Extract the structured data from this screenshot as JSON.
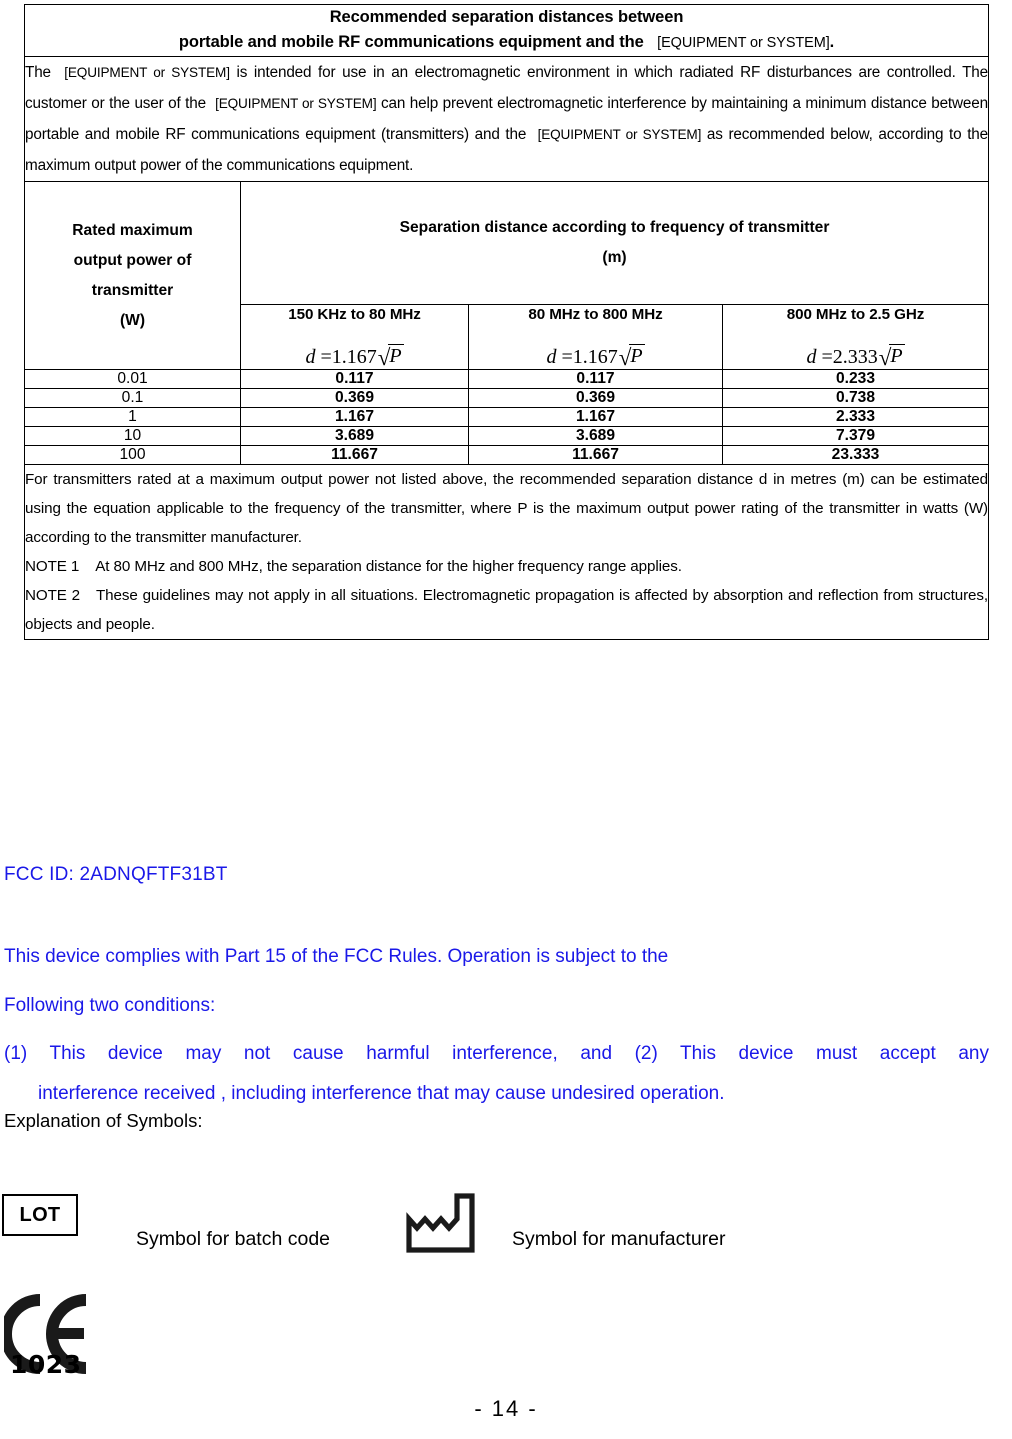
{
  "table": {
    "title_line1": "Recommended separation distances between",
    "title_line2_bold": "portable and mobile RF communications equipment and the",
    "title_line2_bracket": "[EQUIPMENT or SYSTEM]",
    "title_line2_period": ".",
    "intro": {
      "part1": "The",
      "bracket1": "[EQUIPMENT or SYSTEM]",
      "part2": "is intended for use in an electromagnetic environment in which radiated RF disturbances are controlled. The customer or the user of the",
      "bracket2": "[EQUIPMENT or SYSTEM]",
      "part3": "can help prevent electromagnetic interference by maintaining a minimum distance between portable and mobile RF communications equipment (transmitters) and the",
      "bracket3": "[EQUIPMENT or SYSTEM]",
      "part4": "as recommended below, according to the maximum output power of the communications equipment."
    },
    "col_head_left": {
      "l1": "Rated maximum",
      "l2": "output power of",
      "l3": "transmitter",
      "l4": "(W)"
    },
    "col_head_right": {
      "l1": "Separation distance according to frequency of transmitter",
      "l2": "(m)"
    },
    "freq_columns": [
      {
        "label": "150 KHz to 80 MHz",
        "formula_lhs": "d",
        "formula_eq": "=",
        "formula_coeff": "1.167",
        "formula_radical": "√",
        "formula_radicand": "P"
      },
      {
        "label": "80 MHz to 800 MHz",
        "formula_lhs": "d",
        "formula_eq": "=",
        "formula_coeff": "1.167",
        "formula_radical": "√",
        "formula_radicand": "P"
      },
      {
        "label": "800 MHz to 2.5 GHz",
        "formula_lhs": "d",
        "formula_eq": "=",
        "formula_coeff": "2.333",
        "formula_radical": "√",
        "formula_radicand": "P"
      }
    ],
    "rows": [
      {
        "power": "0.01",
        "c1": "0.117",
        "c2": "0.117",
        "c3": "0.233"
      },
      {
        "power": "0.1",
        "c1": "0.369",
        "c2": "0.369",
        "c3": "0.738"
      },
      {
        "power": "1",
        "c1": "1.167",
        "c2": "1.167",
        "c3": "2.333"
      },
      {
        "power": "10",
        "c1": "3.689",
        "c2": "3.689",
        "c3": "7.379"
      },
      {
        "power": "100",
        "c1": "11.667",
        "c2": "11.667",
        "c3": "23.333"
      }
    ],
    "footer": {
      "paragraph": "For transmitters rated at a maximum output power not listed above, the recommended separation distance d in metres (m) can be estimated using the equation applicable to the frequency of the transmitter, where P is the maximum output power rating of the transmitter in watts (W) according to the transmitter manufacturer.",
      "note1_label": "NOTE 1",
      "note1_text": "At 80 MHz and 800 MHz, the separation distance for the higher frequency range applies.",
      "note2_label": "NOTE 2",
      "note2_text": "These guidelines may not apply in all situations. Electromagnetic propagation is affected by absorption and reflection from structures, objects and people."
    }
  },
  "fcc": {
    "id": "FCC ID: 2ADNQFTF31BT",
    "line1": "This device complies with Part 15 of the FCC Rules. Operation is subject to the",
    "line2": "Following two conditions:",
    "line3": "(1) This device may not cause harmful interference, and (2) This device must accept any",
    "line4": "interference received , including interference that may cause undesired operation.",
    "color": "#1a18e8"
  },
  "symbols": {
    "heading": "Explanation of Symbols:",
    "lot_text": "LOT",
    "batch_label": "Symbol for batch code",
    "manufacturer_label": "Symbol for manufacturer"
  },
  "ce": {
    "notified_body_number": "1023"
  },
  "footer": {
    "page_number": "- 14 -"
  }
}
